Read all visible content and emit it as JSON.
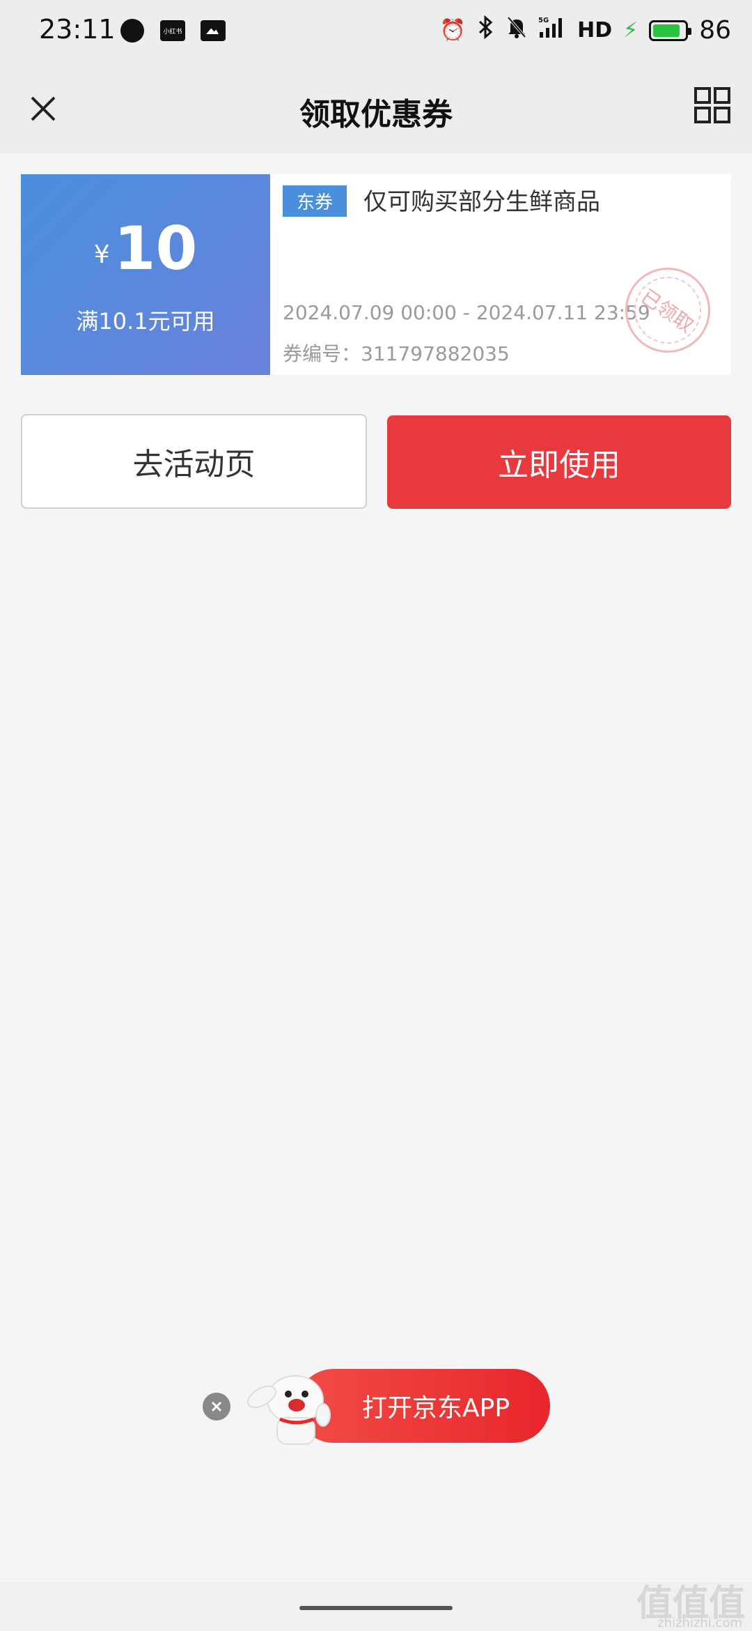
{
  "status_bar": {
    "time": "23:11",
    "rednote_label": "小红书",
    "network": "5G",
    "hd": "HD",
    "battery_percent": "86",
    "battery_level": 0.86
  },
  "header": {
    "title": "领取优惠券",
    "close_icon": "close-icon",
    "grid_icon": "grid-icon"
  },
  "coupon": {
    "currency": "¥",
    "amount": "10",
    "threshold": "满10.1元可用",
    "tag": "东券",
    "description": "仅可购买部分生鲜商品",
    "valid_period": "2024.07.09 00:00 - 2024.07.11 23:59",
    "coupon_id": "券编号：311797882035",
    "stamp": "已领取",
    "colors": {
      "left_gradient_start": "#4a8fdc",
      "left_gradient_end": "#6a82db",
      "tag": "#4a8fdc"
    }
  },
  "actions": {
    "activity_label": "去活动页",
    "use_label": "立即使用",
    "use_color": "#e8393f"
  },
  "app_banner": {
    "label": "打开京东APP",
    "color": "#e8262b"
  },
  "watermark": {
    "text": "值值值",
    "sub": "zhizhizhi.com"
  }
}
